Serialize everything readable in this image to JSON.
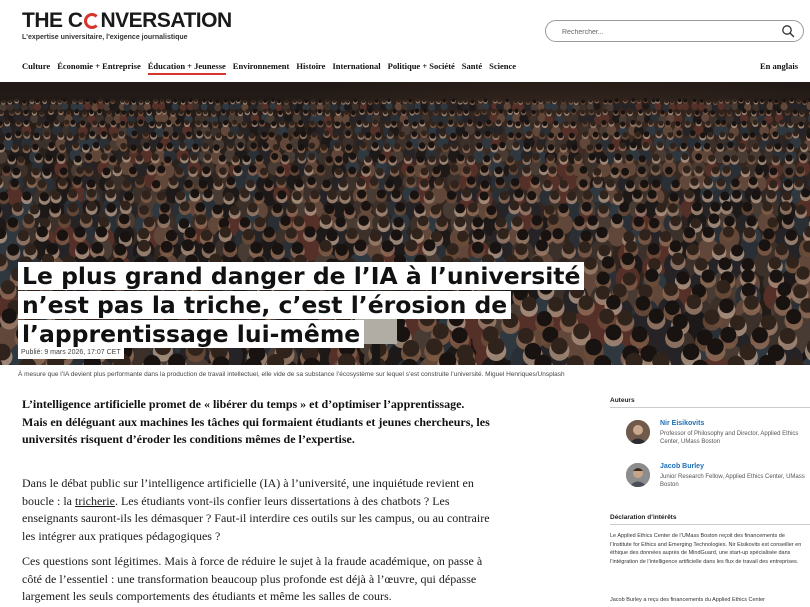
{
  "brand": {
    "logo_pre": "THE C",
    "logo_post": "NVERSATION",
    "tagline": "L'expertise universitaire, l'exigence journalistique",
    "accent_color": "#d8352a"
  },
  "search": {
    "placeholder": "Rechercher..."
  },
  "nav": {
    "items": [
      {
        "label": "Culture"
      },
      {
        "label": "Économie + Entreprise"
      },
      {
        "label": "Éducation + Jeunesse"
      },
      {
        "label": "Environnement"
      },
      {
        "label": "Histoire"
      },
      {
        "label": "International"
      },
      {
        "label": "Politique + Société"
      },
      {
        "label": "Santé"
      },
      {
        "label": "Science"
      }
    ],
    "active": "Éducation + Jeunesse",
    "language_link": "En anglais"
  },
  "article": {
    "headline_lines": [
      "Le plus grand danger de l’IA à l’université",
      "n’est pas la triche, c’est l’érosion de",
      "l’apprentissage lui-même"
    ],
    "published": "Publié: 9 mars 2026, 17:07 CET",
    "caption": "À mesure que l’IA devient plus performante dans la production de travail intellectuel, elle vide de sa substance l’écosystème sur lequel s’est construite l’université. Miguel Henriques/Unsplash",
    "lead": "L’intelligence artificielle promet de « libérer du temps » et d’optimiser l’apprentissage. Mais en déléguant aux machines les tâches qui formaient étudiants et jeunes chercheurs, les universités risquent d’éroder les conditions mêmes de l’expertise.",
    "p1_before": "Dans le débat public sur l’intelligence artificielle (IA) à l’université, une inquiétude revient en boucle : la ",
    "p1_link": "tricherie",
    "p1_after": ". Les étudiants vont-ils confier leurs dissertations à des chatbots ? Les enseignants sauront-ils les démasquer ? Faut-il interdire ces outils sur les campus, ou au contraire les intégrer aux pratiques pédagogiques ?",
    "p2": "Ces questions sont légitimes. Mais à force de réduire le sujet à la fraude académique, on passe à côté de l’essentiel : une transformation beaucoup plus profonde est déjà à l’œuvre, qui dépasse largement les seuls comportements des étudiants et même les salles de cours."
  },
  "sidebar": {
    "authors_heading": "Auteurs",
    "authors": [
      {
        "name": "Nir Eisikovits",
        "role": "Professor of Philosophy and Director, Applied Ethics Center, UMass Boston"
      },
      {
        "name": "Jacob Burley",
        "role": "Junior Research Fellow, Applied Ethics Center, UMass Boston"
      }
    ],
    "disclosure_heading": "Déclaration d’intérêts",
    "disclosure_p1": "Le Applied Ethics Center de l’UMass Boston reçoit des financements de l’Institute for Ethics and Emerging Technologies. Nir Eisikovits est conseiller en éthique des données auprès de MindGuard, une start-up spécialisée dans l’intégration de l’intelligence artificielle dans les flux de travail des entreprises.",
    "disclosure_p2": "Jacob Burley a reçu des financements du Applied Ethics Center"
  }
}
